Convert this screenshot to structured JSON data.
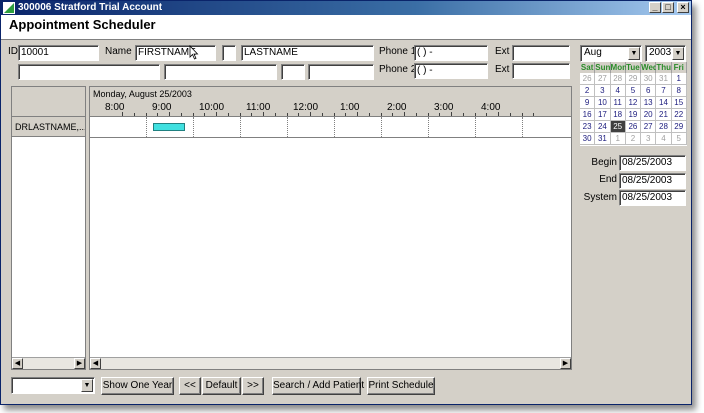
{
  "window": {
    "title": "300006 Stratford Trial Account",
    "controls": [
      "_",
      "□",
      "×"
    ]
  },
  "page_title": "Appointment Scheduler",
  "patient": {
    "id_label": "ID",
    "id_value": "10001",
    "name_label": "Name",
    "first_name": "FIRSTNAME",
    "middle_initial": "",
    "last_name": "LASTNAME",
    "address1": "",
    "address2": "",
    "state": "",
    "zip": "",
    "phone1_label": "Phone 1",
    "phone1_value": "(   )    -",
    "phone2_label": "Phone 2",
    "phone2_value": "(   )    -",
    "ext_label": "Ext",
    "ext1_value": "",
    "ext2_value": "",
    "icons": {
      "cursor": "mouse-pointer-icon"
    }
  },
  "schedule": {
    "date_heading": "Monday, August 25/2003",
    "times": [
      "8:00",
      "9:00",
      "10:00",
      "11:00",
      "12:00",
      "1:00",
      "2:00",
      "3:00",
      "4:00"
    ],
    "providers": [
      {
        "name": "DRLASTNAME,..."
      }
    ],
    "appointment": {
      "start_hour": 8.67,
      "end_hour": 9.33,
      "color": "#40e0e0"
    }
  },
  "calendar": {
    "month": "Aug",
    "year": "2003",
    "day_headers": [
      "Sat",
      "Sun",
      "Mon",
      "Tue",
      "Wed",
      "Thu",
      "Fri"
    ],
    "weeks": [
      [
        "26",
        "27",
        "28",
        "29",
        "30",
        "31",
        "1"
      ],
      [
        "2",
        "3",
        "4",
        "5",
        "6",
        "7",
        "8"
      ],
      [
        "9",
        "10",
        "11",
        "12",
        "13",
        "14",
        "15"
      ],
      [
        "16",
        "17",
        "18",
        "19",
        "20",
        "21",
        "22"
      ],
      [
        "23",
        "24",
        "25",
        "26",
        "27",
        "28",
        "29"
      ],
      [
        "30",
        "31",
        "1",
        "2",
        "3",
        "4",
        "5"
      ]
    ],
    "selected_day": "25",
    "header_color": "#2a8c2a"
  },
  "range": {
    "begin_label": "Begin",
    "begin_value": "08/25/2003",
    "end_label": "End",
    "end_value": "08/25/2003",
    "system_label": "System",
    "system_value": "08/25/2003"
  },
  "toolbar": {
    "filter_value": "",
    "show_one_year": "Show One Year",
    "prev": "<<",
    "default": "Default",
    "next": ">>",
    "search_add_patient": "Search / Add Patient",
    "print_schedule": "Print Schedule"
  }
}
